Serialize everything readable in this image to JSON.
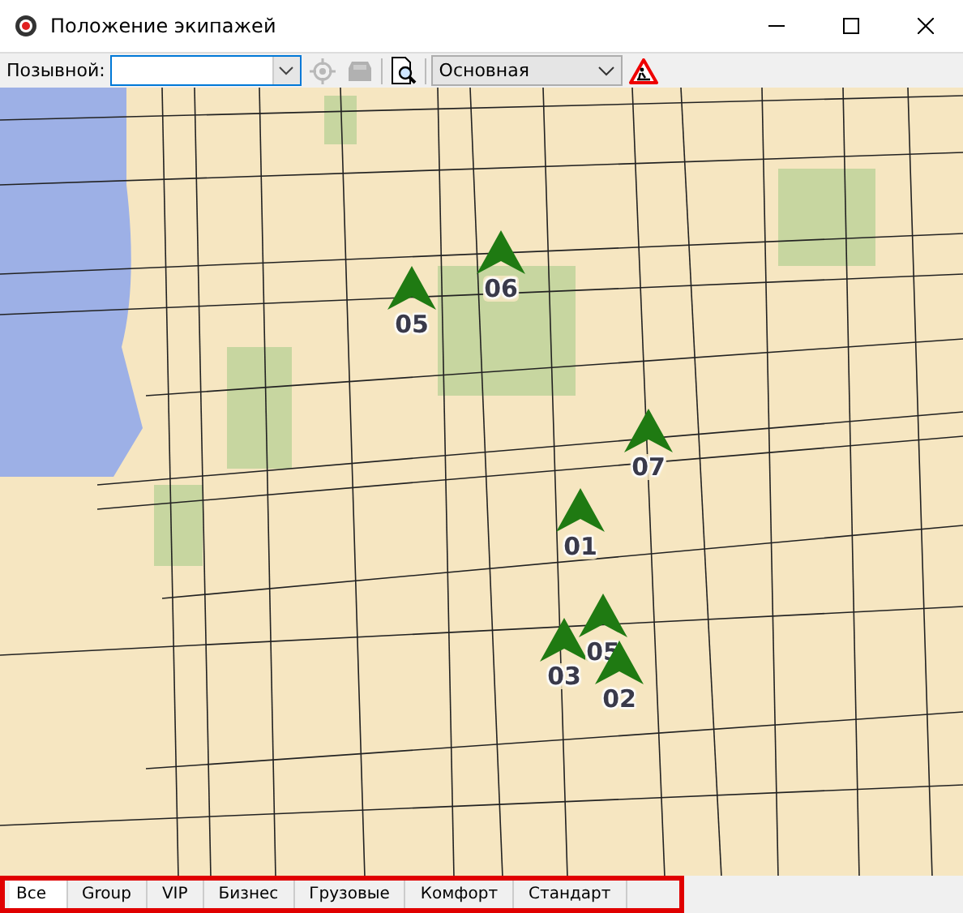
{
  "window": {
    "title": "Положение экипажей"
  },
  "toolbar": {
    "callsign_label": "Позывной:",
    "locate_button": {
      "disabled": true
    },
    "vehicle_button": {
      "disabled": true
    },
    "layer_select": {
      "value": "Основная"
    }
  },
  "vehicles": [
    {
      "number": "05"
    },
    {
      "number": "06"
    },
    {
      "number": "07"
    },
    {
      "number": "01"
    },
    {
      "number": "03"
    },
    {
      "number": "05"
    },
    {
      "number": "02"
    }
  ],
  "tabs": [
    {
      "label": "Все",
      "selected": true
    },
    {
      "label": "Group",
      "selected": false
    },
    {
      "label": "VIP",
      "selected": false
    },
    {
      "label": "Бизнес",
      "selected": false
    },
    {
      "label": "Грузовые",
      "selected": false
    },
    {
      "label": "Комфорт",
      "selected": false
    },
    {
      "label": "Стандарт",
      "selected": false
    }
  ]
}
